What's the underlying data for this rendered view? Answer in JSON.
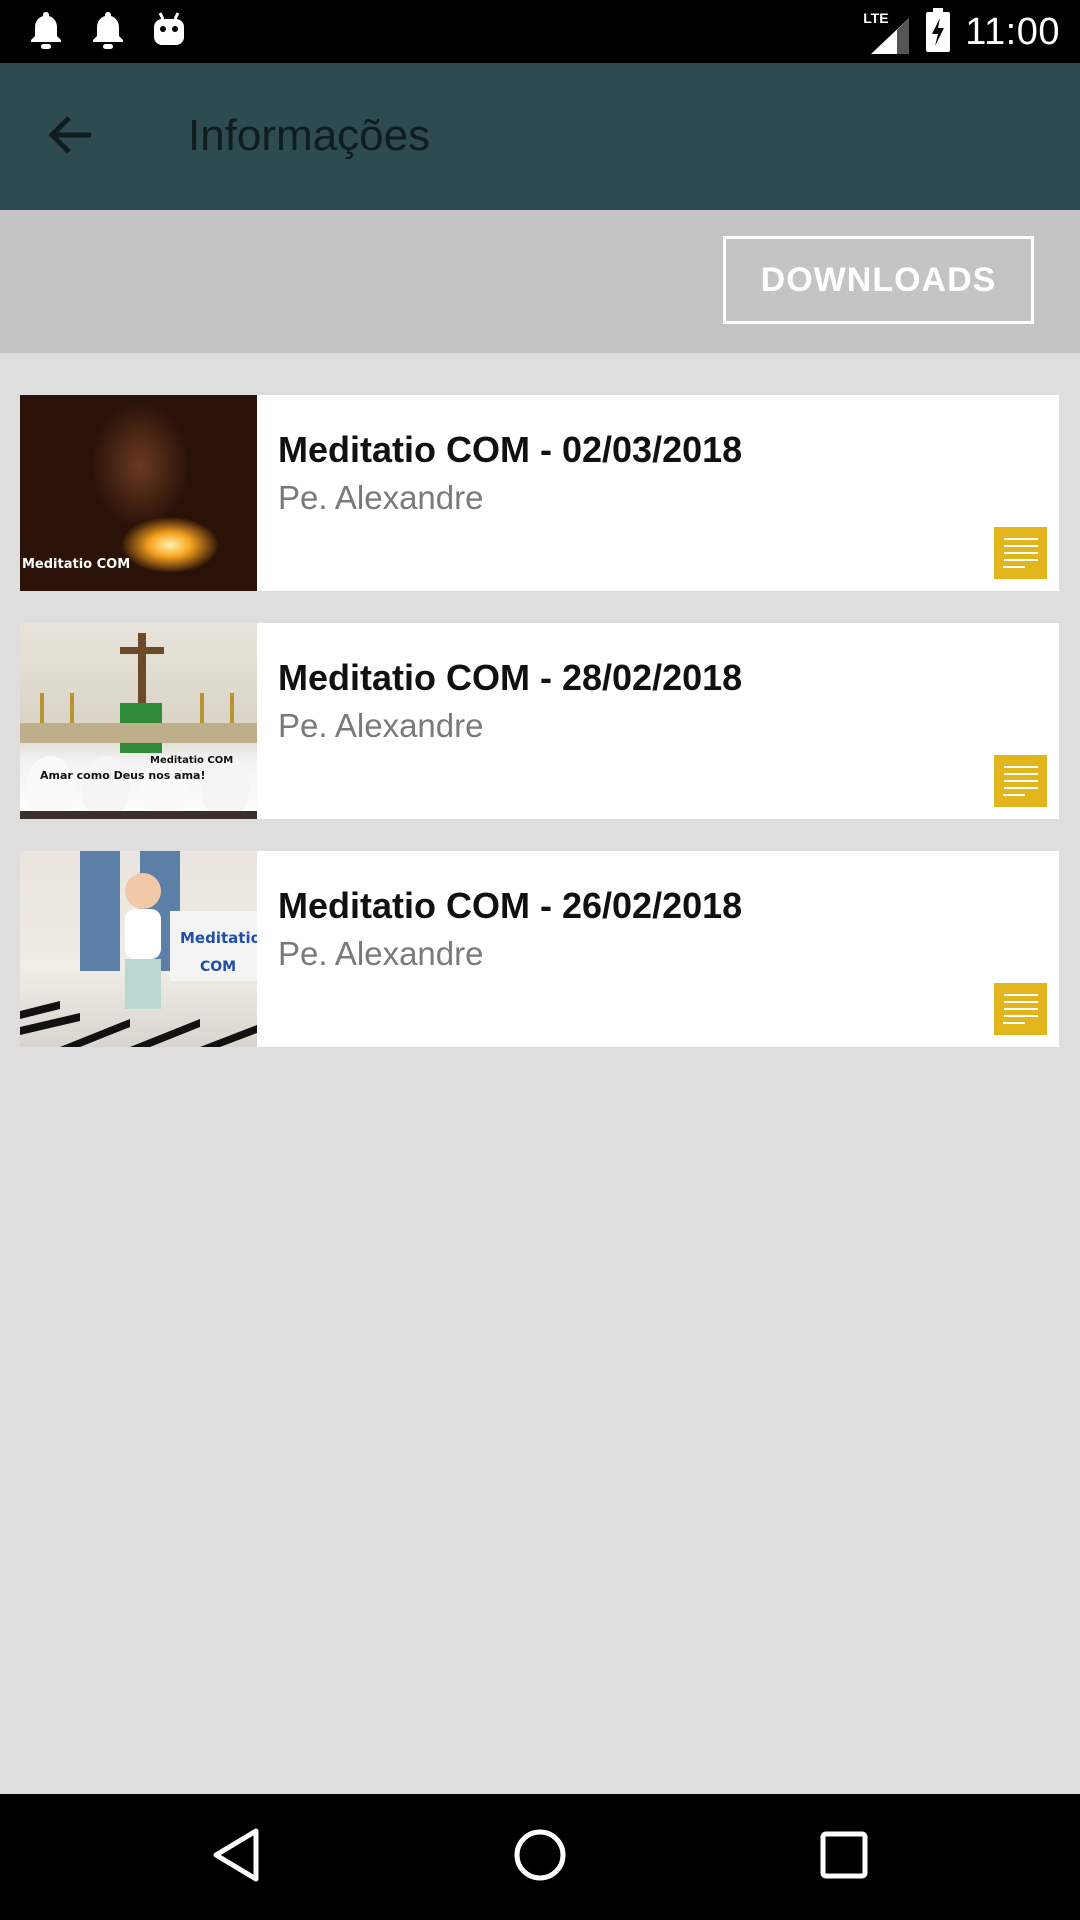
{
  "status_bar": {
    "icons_left": [
      "notification-bell-icon",
      "notification-bell-icon",
      "android-icon"
    ],
    "network": "LTE",
    "time": "11:00"
  },
  "app_bar": {
    "title": "Informações",
    "back_icon": "arrow-back-icon"
  },
  "toolbar": {
    "downloads_label": "DOWNLOADS"
  },
  "items": [
    {
      "title": "Meditatio COM - 02/03/2018",
      "author": "Pe. Alexandre",
      "thumb_caption": "Meditatio COM",
      "icon": "text-lines-icon"
    },
    {
      "title": "Meditatio COM - 28/02/2018",
      "author": "Pe. Alexandre",
      "thumb_caption": "Meditatio COM",
      "thumb_caption2": "Amar como Deus nos ama!",
      "icon": "text-lines-icon"
    },
    {
      "title": "Meditatio COM - 26/02/2018",
      "author": "Pe. Alexandre",
      "thumb_caption": "Meditatio",
      "thumb_caption2": "COM",
      "icon": "text-lines-icon"
    }
  ],
  "colors": {
    "app_bar": "#2e4b50",
    "accent_icon": "#e2b51d",
    "background": "#dedede"
  }
}
